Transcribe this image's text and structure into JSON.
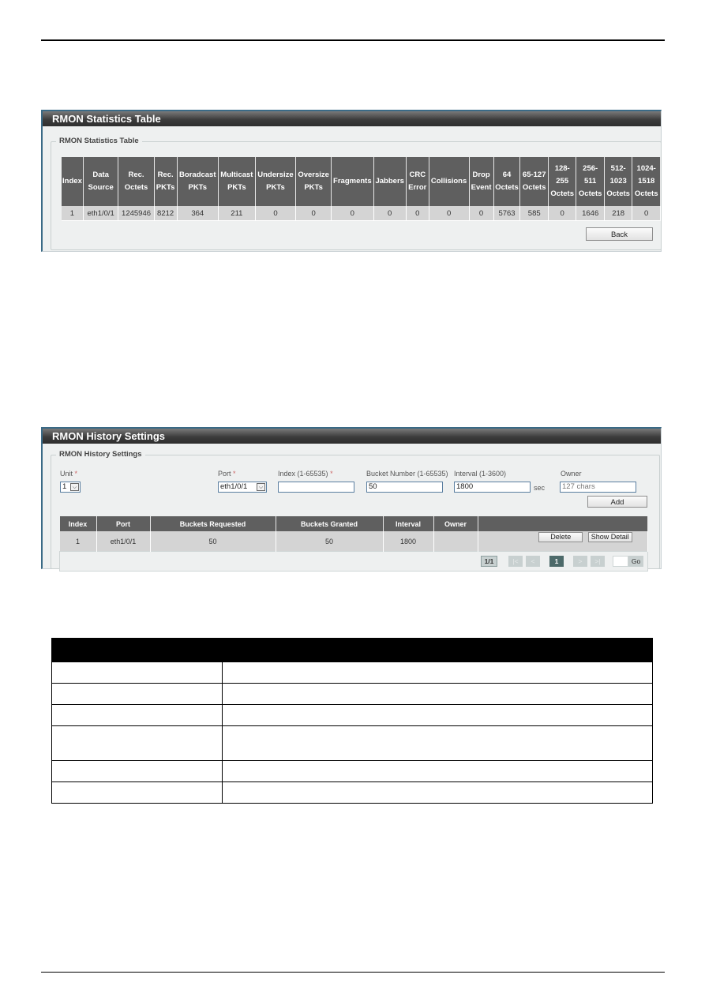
{
  "statistics_panel": {
    "title": "RMON Statistics Table",
    "legend": "RMON Statistics Table",
    "columns": [
      [
        "Index"
      ],
      [
        "Data",
        "Source"
      ],
      [
        "Rec.",
        "Octets"
      ],
      [
        "Rec.",
        "PKTs"
      ],
      [
        "Boradcast",
        "PKTs"
      ],
      [
        "Multicast",
        "PKTs"
      ],
      [
        "Undersize",
        "PKTs"
      ],
      [
        "Oversize",
        "PKTs"
      ],
      [
        "Fragments"
      ],
      [
        "Jabbers"
      ],
      [
        "CRC",
        "Error"
      ],
      [
        "Collisions"
      ],
      [
        "Drop",
        "Event"
      ],
      [
        "64",
        "Octets"
      ],
      [
        "65-127",
        "Octets"
      ],
      [
        "128-",
        "255",
        "Octets"
      ],
      [
        "256-",
        "511",
        "Octets"
      ],
      [
        "512-",
        "1023",
        "Octets"
      ],
      [
        "1024-",
        "1518",
        "Octets"
      ]
    ],
    "rows": [
      [
        "1",
        "eth1/0/1",
        "1245946",
        "8212",
        "364",
        "211",
        "0",
        "0",
        "0",
        "0",
        "0",
        "0",
        "0",
        "5763",
        "585",
        "0",
        "1646",
        "218",
        "0"
      ]
    ],
    "back_label": "Back"
  },
  "history_panel": {
    "title": "RMON History Settings",
    "legend": "RMON History Settings",
    "fields": {
      "unit": {
        "label": "Unit",
        "required": "*",
        "value": "1"
      },
      "port": {
        "label": "Port",
        "required": "*",
        "value": "eth1/0/1"
      },
      "index": {
        "label": "Index (1-65535)",
        "required": "*",
        "value": ""
      },
      "bucket": {
        "label": "Bucket Number (1-65535)",
        "value": "50"
      },
      "interval": {
        "label": "Interval (1-3600)",
        "value": "1800",
        "unit": "sec"
      },
      "owner": {
        "label": "Owner",
        "placeholder": "127 chars"
      }
    },
    "add_label": "Add",
    "table": {
      "columns": [
        "Index",
        "Port",
        "Buckets Requested",
        "Buckets Granted",
        "Interval",
        "Owner",
        ""
      ],
      "rows": [
        {
          "index": "1",
          "port": "eth1/0/1",
          "requested": "50",
          "granted": "50",
          "interval": "1800",
          "owner": ""
        }
      ],
      "delete_label": "Delete",
      "show_detail_label": "Show Detail"
    },
    "pager": {
      "total": "1/1",
      "first": "|<",
      "prev": "<",
      "current": "1",
      "next": ">",
      "last": ">|",
      "go_label": "Go"
    }
  },
  "description_table": {
    "rows": 6
  }
}
